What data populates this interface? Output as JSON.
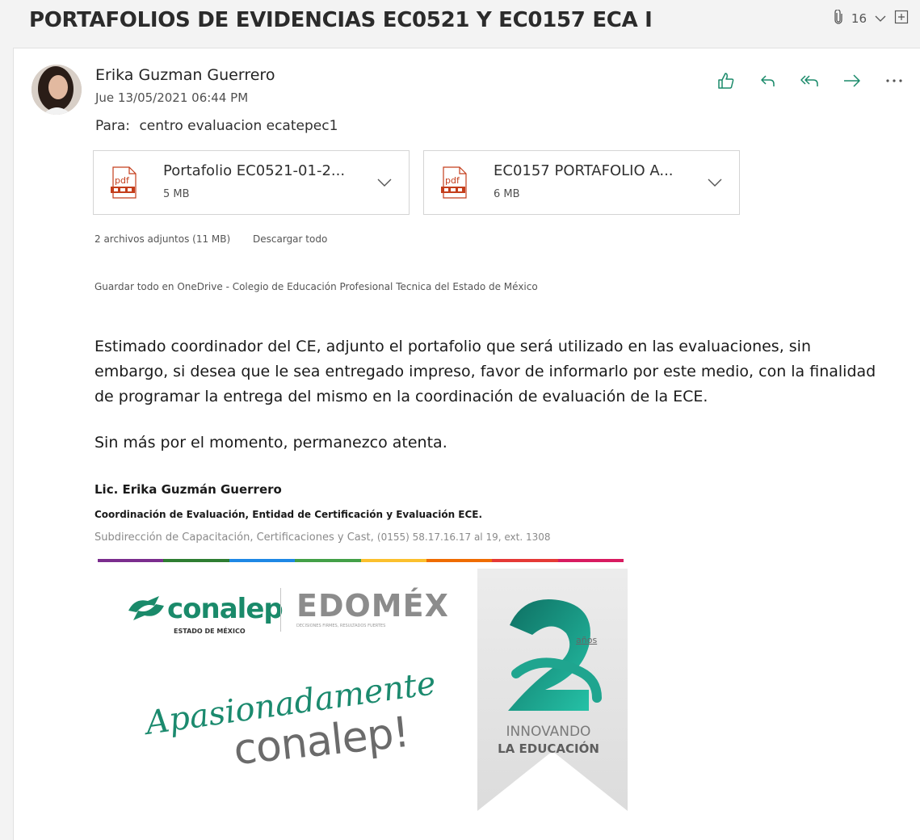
{
  "email": {
    "subject": "PORTAFOLIOS DE EVIDENCIAS EC0521 Y EC0157 ECA I",
    "attachment_count": "16",
    "sender": "Erika Guzman Guerrero",
    "date": "Jue 13/05/2021 06:44 PM",
    "to_label": "Para:",
    "to_value": "centro evaluacion ecatepec1"
  },
  "actions": [
    "like-icon",
    "reply-icon",
    "reply-all-icon",
    "forward-icon",
    "more-icon"
  ],
  "attachments": [
    {
      "icon_label": "pdf",
      "name": "Portafolio EC0521-01-2...",
      "size": "5 MB"
    },
    {
      "icon_label": "pdf",
      "name": "EC0157 PORTAFOLIO A...",
      "size": "6 MB"
    }
  ],
  "attachments_summary": "2 archivos adjuntos (11 MB)",
  "download_all": "Descargar todo",
  "save_onedrive": "Guardar todo en OneDrive - Colegio de Educación Profesional Tecnica del Estado de México",
  "body": {
    "paragraph": "Estimado coordinador del CE, adjunto el portafolio que será utilizado en las evaluaciones, sin embargo, si desea que le sea entregado impreso, favor de informarlo por este medio, con la finalidad de programar la entrega del mismo en la coordinación de evaluación de la ECE.",
    "closing": "Sin más por el momento, permanezco atenta."
  },
  "signature": {
    "name": "Lic. Erika Guzmán Guerrero",
    "department": "Coordinación de Evaluación, Entidad de Certificación y Evaluación ECE.",
    "subdirection": "Subdirección de Capacitación, Certificaciones y Cast,",
    "phone": "(0155) 58.17.16.17 al 19, ext. 1308"
  },
  "banner": {
    "conalep": "conalep",
    "conalep_sub": "ESTADO DE MÉXICO",
    "edomex": "EDOMÉX",
    "edomex_sub": "DECISIONES FIRMES, RESULTADOS FUERTES",
    "slogan_script": "Apasionadamente",
    "slogan_word": "conalep!",
    "ribbon_line1": "INNOVANDO",
    "ribbon_line2": "LA EDUCACIÓN",
    "anos": "años"
  },
  "colors": {
    "accent_green": "#1a8a6a",
    "bar": [
      "#7b2d8e",
      "#2e7d32",
      "#1e88e5",
      "#43a047",
      "#fbc02d",
      "#ef6c00",
      "#e53935",
      "#d81b60"
    ]
  }
}
